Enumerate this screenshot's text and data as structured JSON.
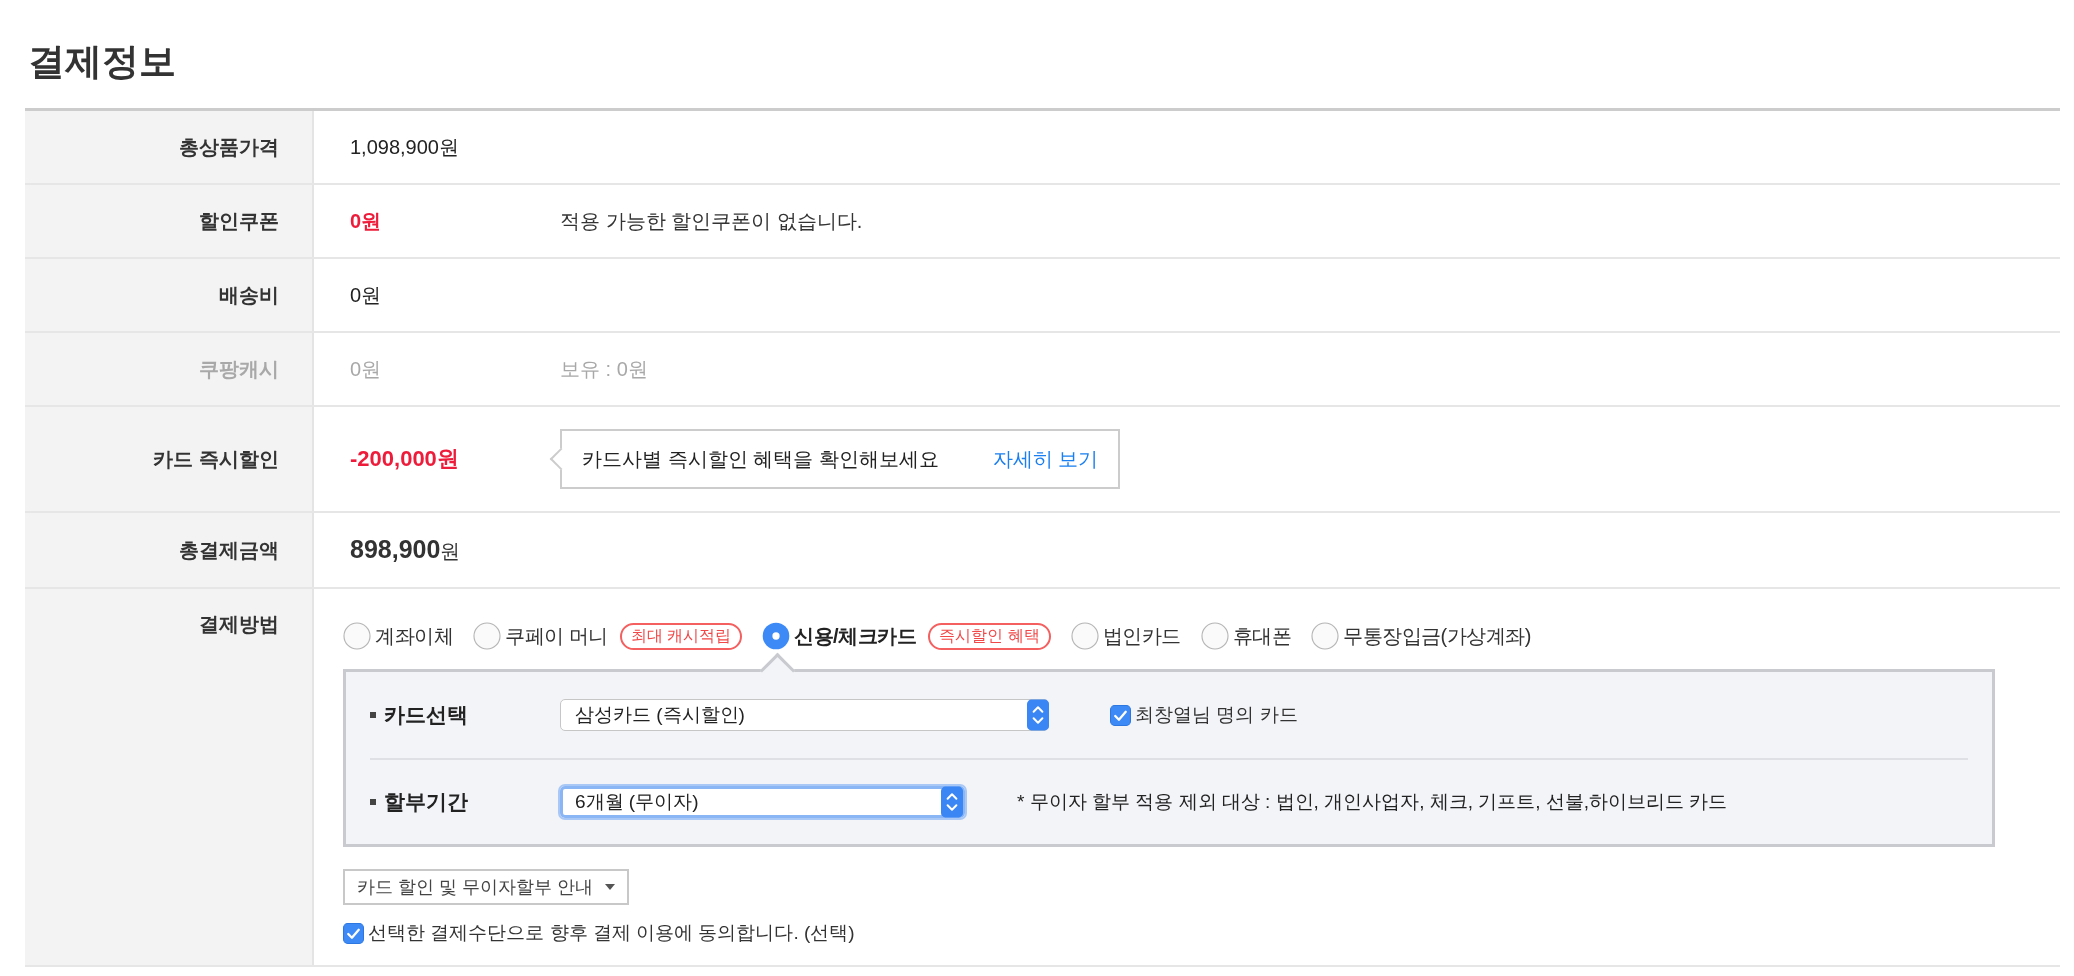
{
  "title": "결제정보",
  "rows": [
    {
      "kind": "amount",
      "label": "총상품가격",
      "value": "1,098,900원",
      "emphasis": false,
      "disabled": false
    },
    {
      "kind": "amount",
      "label": "할인쿠폰",
      "value": "0원",
      "emphasis": true,
      "note": "적용 가능한 할인쿠폰이 없습니다.",
      "disabled": false
    },
    {
      "kind": "amount",
      "label": "배송비",
      "value": "0원",
      "emphasis": false,
      "disabled": false
    },
    {
      "kind": "amount",
      "label": "쿠팡캐시",
      "value": "0원",
      "emphasis": false,
      "note": "보유 : 0원",
      "disabled": true
    },
    {
      "kind": "discount",
      "label": "카드 즉시할인",
      "value": "-200,000원",
      "emphasis": true,
      "tooltip": "카드사별 즉시할인 혜택을 확인해보세요",
      "link": "자세히 보기"
    },
    {
      "kind": "total",
      "label": "총결제금액",
      "amount": "898,900",
      "unit": "원"
    },
    {
      "kind": "payment",
      "label": "결제방법",
      "methods": [
        {
          "label": "계좌이체",
          "selected": false
        },
        {
          "label": "쿠페이 머니",
          "badge": "최대 캐시적립",
          "selected": false
        },
        {
          "label": "신용/체크카드",
          "badge": "즉시할인 혜택",
          "selected": true
        },
        {
          "label": "법인카드",
          "selected": false
        },
        {
          "label": "휴대폰",
          "selected": false
        },
        {
          "label": "무통장입금(가상계좌)",
          "selected": false
        }
      ],
      "card_panel": [
        {
          "label": "카드선택",
          "value": "삼성카드 (즉시할인)",
          "focused": false,
          "checkbox": {
            "label": "최창열님 명의 카드",
            "checked": true
          }
        },
        {
          "label": "할부기간",
          "value": "6개월 (무이자)",
          "focused": true,
          "note": "* 무이자 할부 적용 제외 대상 : 법인, 개인사업자, 체크, 기프트, 선불,하이브리드 카드"
        }
      ],
      "guide_button": "카드 할인 및 무이자할부 안내",
      "agreement": {
        "label": "선택한 결제수단으로 향후 결제 이용에 동의합니다. (선택)",
        "checked": true
      }
    }
  ]
}
